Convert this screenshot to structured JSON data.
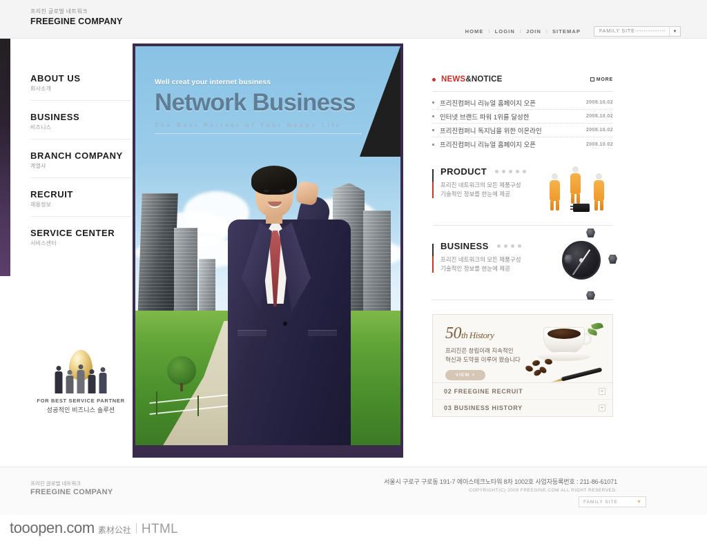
{
  "header": {
    "logo_kr": "프리진 글로벌 네트워크",
    "logo_en": "FREEGINE COMPANY",
    "nav": [
      {
        "label": "HOME"
      },
      {
        "label": "LOGIN"
      },
      {
        "label": "JOIN"
      },
      {
        "label": "SITEMAP"
      }
    ],
    "separator": "I",
    "family_site": {
      "label": "FAMILY SITE--------------",
      "arrow": "chevron-down-icon"
    }
  },
  "sidebar": {
    "items": [
      {
        "en": "ABOUT US",
        "kr": "회사소개"
      },
      {
        "en": "BUSINESS",
        "kr": "비즈니스"
      },
      {
        "en": "BRANCH COMPANY",
        "kr": "계열사"
      },
      {
        "en": "RECRUIT",
        "kr": "채용정보"
      },
      {
        "en": "SERVICE CENTER",
        "kr": "서비스센터"
      }
    ],
    "badge": {
      "en": "FOR BEST SERVICE PARTNER",
      "kr": "성공적인 비즈니스 솔루션"
    }
  },
  "hero": {
    "subtitle": "Well creat your internet business",
    "title": "Network Business",
    "tagline": "The Best Partner of Your Happy Life"
  },
  "news": {
    "title_accent": "NEWS",
    "title_rest": "&NOTICE",
    "more_label": "MORE",
    "items": [
      {
        "text": "프리진컴퍼니 리뉴얼 홈페이지 오픈",
        "date": "2008.10.02"
      },
      {
        "text": "인터넷 브랜드 파워 1위를 달성한",
        "date": "2008.10.02"
      },
      {
        "text": "프리진컴퍼니 독지님을 위한 이온라인",
        "date": "2008.10.02"
      },
      {
        "text": "프리진컴퍼니 리뉴얼 홈페이지 오픈",
        "date": "2008.10.02"
      }
    ]
  },
  "promos": [
    {
      "title": "PRODUCT",
      "desc_line1": "프리진 네트워크의 모든 제품구성",
      "desc_line2": "기술적인 정보를 한눈에 제공",
      "dots": 5,
      "icon": "workers-chip-icon"
    },
    {
      "title": "BUSINESS",
      "desc_line1": "프리진 네트워크의 모든 제품구성",
      "desc_line2": "기술적인 정보를 한눈에 제공",
      "dots": 4,
      "icon": "compass-icon"
    }
  ],
  "history": {
    "heading_number": "50",
    "heading_suffix": "th History",
    "desc_line1": "프리진은 창립이래 지속적인",
    "desc_line2": "혁신과 도약을 이루어 왔습니다",
    "view_label": "VIEW",
    "view_plus": "+",
    "rows": [
      {
        "label": "02 FREEGINE RECRUIT",
        "plus": "+"
      },
      {
        "label": "03 BUSINESS HISTORY",
        "plus": "+"
      }
    ]
  },
  "footer": {
    "logo_kr": "프리진 글로벌 네트워크",
    "logo_en": "FREEGINE COMPANY",
    "address": "서울시 구로구 구로동 191-7 에이스테크노타워 8차 1002호  사업자등록번호 : 211-86-61071",
    "copyright": "COPYRIGHT(C) 2009 FREEGINE.COM ALL RIGHT RESERVED.",
    "family_site": {
      "label": "FAMILY SITE",
      "arrow": "chevron-down-icon"
    }
  },
  "watermark": {
    "part1": "tooopen.com",
    "part2": "素材公社",
    "part3": "HTML"
  },
  "colors": {
    "accent_red": "#cf2b2b",
    "hero_purple": "#3b2c4e",
    "sky_blue": "#8cc3e6",
    "history_beige": "#d6c6b6"
  }
}
